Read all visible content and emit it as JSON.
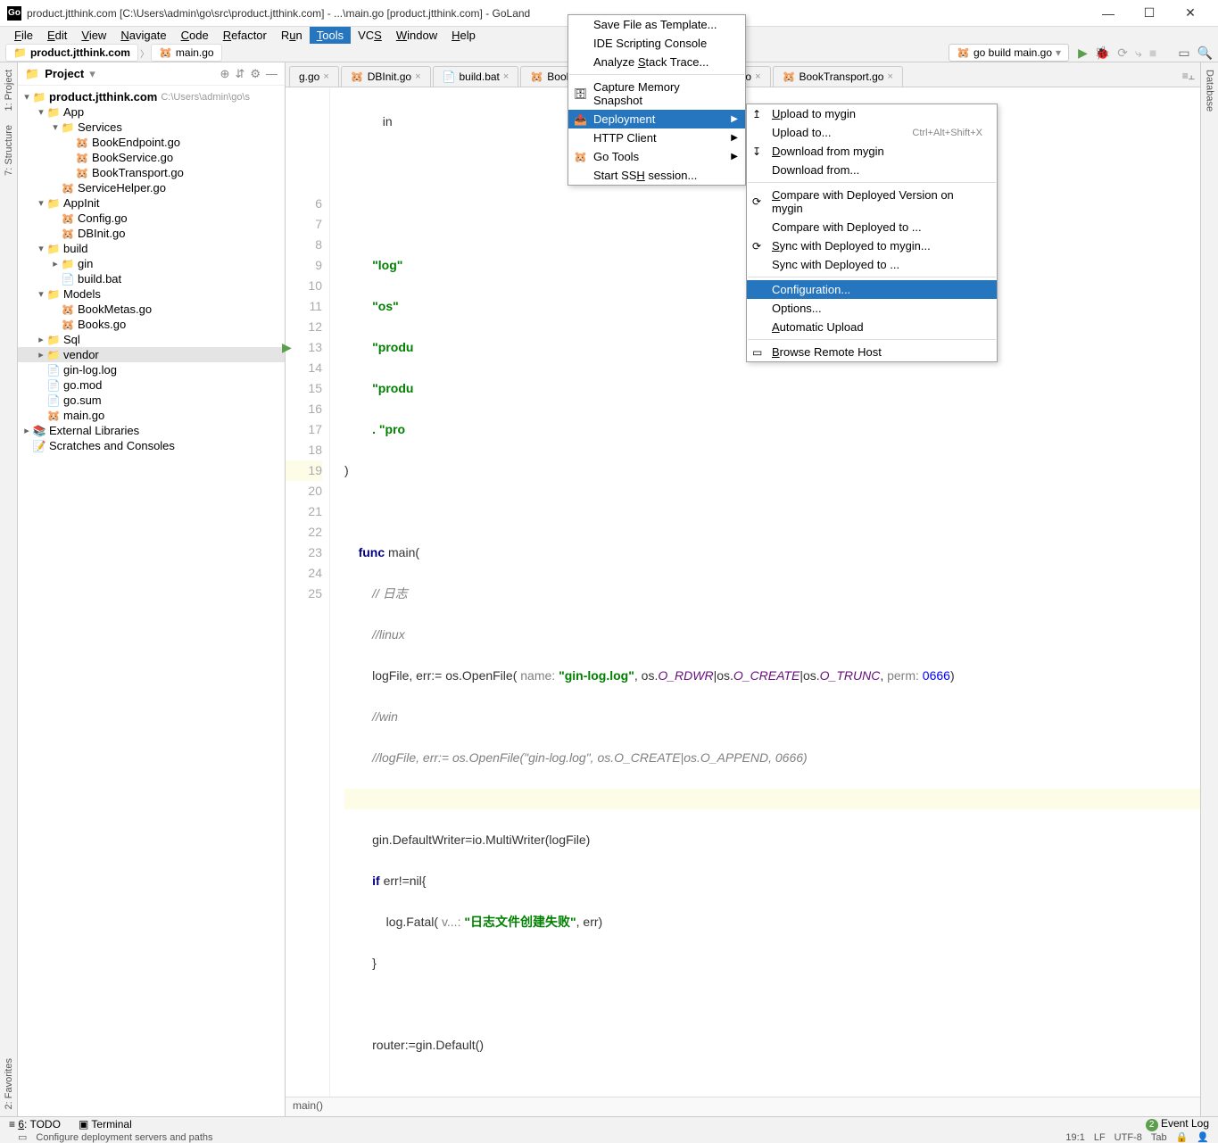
{
  "window": {
    "title": "product.jtthink.com [C:\\Users\\admin\\go\\src\\product.jtthink.com] - ...\\main.go [product.jtthink.com] - GoLand"
  },
  "menu": {
    "file": "File",
    "edit": "Edit",
    "view": "View",
    "navigate": "Navigate",
    "code": "Code",
    "refactor": "Refactor",
    "run": "Run",
    "tools": "Tools",
    "vcs": "VCS",
    "window": "Window",
    "help": "Help"
  },
  "nav": {
    "project": "product.jtthink.com",
    "file": "main.go"
  },
  "runconfig": {
    "label": "go build main.go"
  },
  "projectview": {
    "header": "Project",
    "root": "product.jtthink.com",
    "root_path": "C:\\Users\\admin\\go\\s",
    "items": [
      "App",
      "Services",
      "BookEndpoint.go",
      "BookService.go",
      "BookTransport.go",
      "ServiceHelper.go",
      "AppInit",
      "Config.go",
      "DBInit.go",
      "build",
      "gin",
      "build.bat",
      "Models",
      "BookMetas.go",
      "Books.go",
      "Sql",
      "vendor",
      "gin-log.log",
      "go.mod",
      "go.sum",
      "main.go",
      "External Libraries",
      "Scratches and Consoles"
    ]
  },
  "editor_tabs": [
    "g.go",
    "DBInit.go",
    "build.bat",
    "BookService.go",
    "BookEndpoint.go",
    "BookTransport.go"
  ],
  "code_first_visible": "in",
  "code": {
    "l6": "\"log\"",
    "l7": "\"os\"",
    "l8": "\"produ",
    "l9": "\"produ",
    "l10": ". \"pro",
    "l11": ")",
    "l12": "",
    "l13_a": "func ",
    "l13_b": "main(",
    "l14": "// 日志",
    "l15": "//linux",
    "l16_a": "logFile, err:= os.OpenFile( ",
    "l16_name": "name: ",
    "l16_b": "\"gin-log.log\"",
    "l16_c": ", os.",
    "l16_rd": "O_RDWR",
    "l16_d": "|os.",
    "l16_cr": "O_CREATE",
    "l16_e": "|os.",
    "l16_tr": "O_TRUNC",
    "l16_f": ", ",
    "l16_perm": "perm: ",
    "l16_num": "0666",
    "l16_g": ")",
    "l17": "//win",
    "l18": "//logFile, err:= os.OpenFile(\"gin-log.log\", os.O_CREATE|os.O_APPEND, 0666)",
    "l20": "gin.DefaultWriter=io.MultiWriter(logFile)",
    "l21_a": "if ",
    "l21_b": "err!=nil{",
    "l22_a": "    log.Fatal( ",
    "l22_v": "v...: ",
    "l22_b": "\"日志文件创建失败\"",
    "l22_c": ", err)",
    "l23": "}",
    "l25": "router:=gin.Default()"
  },
  "breadcrumb_bottom": "main()",
  "tools_menu": {
    "save_tpl": "Save File as Template...",
    "ide_script": "IDE Scripting Console",
    "stack": "Analyze Stack Trace...",
    "mem": "Capture Memory Snapshot",
    "deploy": "Deployment",
    "http": "HTTP Client",
    "gotools": "Go Tools",
    "ssh": "Start SSH session..."
  },
  "deploy_menu": {
    "up_mygin": "Upload to mygin",
    "up_to": "Upload to...",
    "up_to_sc": "Ctrl+Alt+Shift+X",
    "dl_mygin": "Download from mygin",
    "dl_from": "Download from...",
    "cmp_mygin": "Compare with Deployed Version on mygin",
    "cmp_to": "Compare with Deployed to ...",
    "sync_mygin": "Sync with Deployed to mygin...",
    "sync_to": "Sync with Deployed to ...",
    "config": "Configuration...",
    "options": "Options...",
    "auto": "Automatic Upload",
    "browse": "Browse Remote Host"
  },
  "bottom": {
    "todo": "6: TODO",
    "terminal": "Terminal",
    "eventlog": "Event Log"
  },
  "footer": {
    "msg": "Configure deployment servers and paths",
    "pos": "19:1",
    "le": "LF",
    "enc": "UTF-8",
    "tab": "Tab"
  },
  "sidetabs": {
    "project": "1: Project",
    "structure": "7: Structure",
    "favorites": "2: Favorites",
    "database": "Database"
  }
}
